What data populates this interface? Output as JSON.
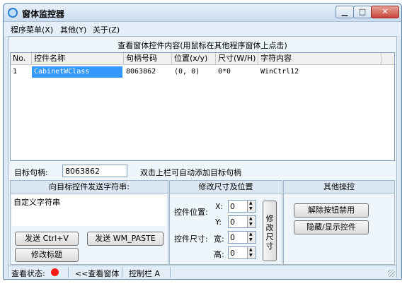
{
  "window": {
    "title": "窗体监控器"
  },
  "menu": {
    "items": [
      "程序菜单(X)",
      "其他(Y)",
      "关于(Z)"
    ]
  },
  "list": {
    "title": "查看窗体控件内容(用鼠标在其他程序窗体上点击)",
    "columns": [
      "No.",
      "控件名称",
      "句柄号码",
      "位置(x/y)",
      "尺寸(W/H)",
      "字符内容"
    ],
    "rows": [
      [
        "1",
        "CabinetWClass",
        "8063862",
        "(0, 0)",
        "0*0",
        "WinCtrl12"
      ]
    ]
  },
  "target": {
    "label": "目标句柄:",
    "value": "8063862",
    "hint": "双击上栏可自动添加目标句柄"
  },
  "send_panel": {
    "title": "向目标控件发送字符串:",
    "text_value": "自定义字符串",
    "btn_ctrl_v": "发送 Ctrl+V",
    "btn_wm_paste": "发送 WM_PASTE",
    "btn_modify_title": "修改标题"
  },
  "resize_panel": {
    "title": "修改尺寸及位置",
    "pos_label": "控件位置:",
    "size_label": "控件尺寸:",
    "x_label": "X:",
    "y_label": "Y:",
    "w_label": "宽:",
    "h_label": "高:",
    "x_value": "0",
    "y_value": "0",
    "w_value": "0",
    "h_value": "0",
    "modify_btn": "修改尺寸"
  },
  "other_panel": {
    "title": "其他操控",
    "btn_unlock": "解除按钮禁用",
    "btn_toggle": "隐藏/显示控件"
  },
  "status": {
    "label": "查看状态:",
    "view_window": "<<查看窗体",
    "control_bar": "控制栏 A",
    "dot_color": "#ff1a1a"
  }
}
